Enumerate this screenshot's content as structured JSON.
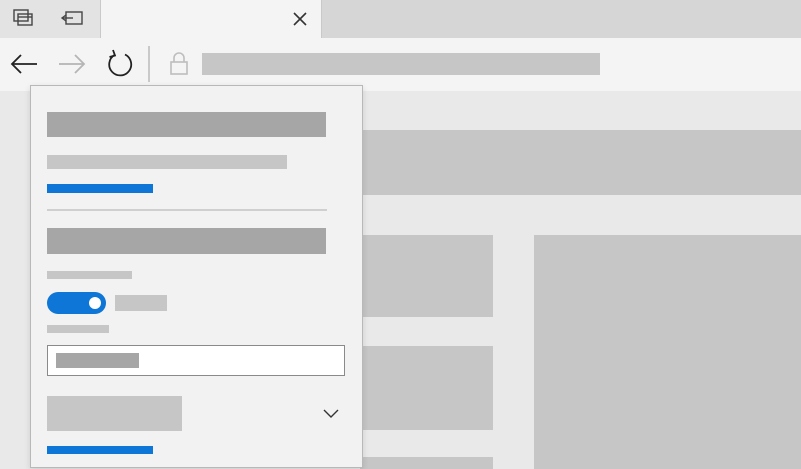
{
  "colors": {
    "accent": "#0e76d6",
    "placeholder_dark": "#a6a6a6",
    "placeholder_light": "#c6c6c6",
    "panel_bg": "#f2f2f2",
    "chrome_bg": "#f4f4f4"
  },
  "tabs": {
    "icons": [
      "tab-preview-icon",
      "set-aside-tabs-icon"
    ],
    "active_close_icon": "close-icon"
  },
  "nav": {
    "back_icon": "arrow-left-icon",
    "forward_icon": "arrow-right-icon",
    "refresh_icon": "refresh-icon",
    "lock_icon": "lock-icon"
  },
  "panel": {
    "toggle_on": true,
    "dropdown_icon": "chevron-down-icon"
  }
}
